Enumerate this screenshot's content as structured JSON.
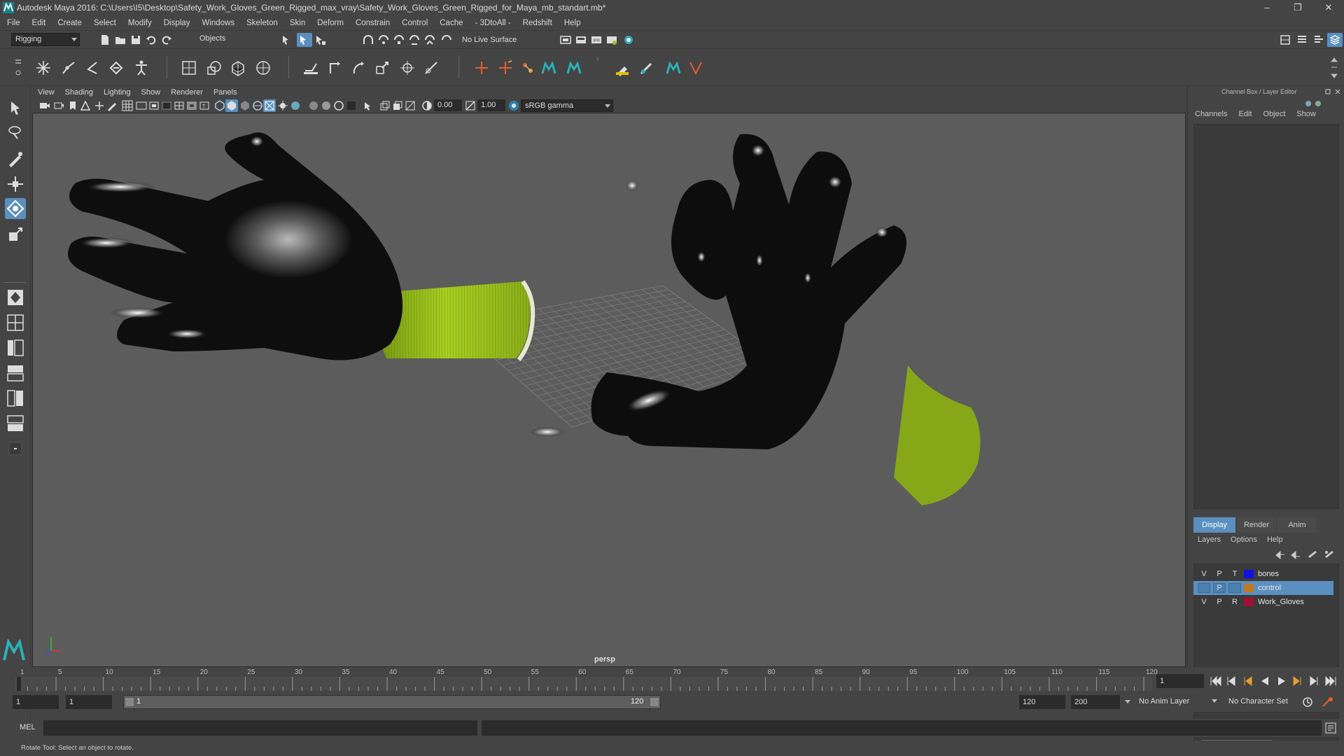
{
  "window": {
    "title": "Autodesk Maya 2016: C:\\Users\\I5\\Desktop\\Safety_Work_Gloves_Green_Rigged_max_vray\\Safety_Work_Gloves_Green_Rigged_for_Maya_mb_standart.mb*",
    "minimize": "–",
    "restore": "❐",
    "close": "✕"
  },
  "menubar": [
    "File",
    "Edit",
    "Create",
    "Select",
    "Modify",
    "Display",
    "Windows",
    "Skeleton",
    "Skin",
    "Deform",
    "Constrain",
    "Control",
    "Cache",
    "- 3DtoAll -",
    "Redshift",
    "Help"
  ],
  "statusline": {
    "mode": "Rigging",
    "selection_mode": "Objects",
    "live_surface": "No Live Surface"
  },
  "panel_menu": [
    "View",
    "Shading",
    "Lighting",
    "Show",
    "Renderer",
    "Panels"
  ],
  "panel_toolbar": {
    "exposure": "0.00",
    "gamma": "1.00",
    "color_space": "sRGB gamma"
  },
  "viewport": {
    "camera_label": "persp"
  },
  "channel_box": {
    "header": "Channel Box / Layer Editor",
    "menu": [
      "Channels",
      "Edit",
      "Object",
      "Show"
    ]
  },
  "layer_editor": {
    "tabs": [
      "Display",
      "Render",
      "Anim"
    ],
    "active_tab": "Display",
    "menu": [
      "Layers",
      "Options",
      "Help"
    ],
    "layers": [
      {
        "v": "V",
        "p": "P",
        "t": "T",
        "name": "bones",
        "color": "#1010e0",
        "selected": false
      },
      {
        "v": "",
        "p": "P",
        "t": "",
        "name": "control",
        "color": "#c07820",
        "selected": true
      },
      {
        "v": "V",
        "p": "P",
        "t": "R",
        "name": "Work_Gloves",
        "color": "#a01030",
        "selected": false
      }
    ]
  },
  "timeline": {
    "ticks": [
      "1",
      "5",
      "10",
      "15",
      "20",
      "25",
      "30",
      "35",
      "40",
      "45",
      "50",
      "55",
      "60",
      "65",
      "70",
      "75",
      "80",
      "85",
      "90",
      "95",
      "100",
      "105",
      "110",
      "115",
      "120"
    ],
    "current_frame": "1"
  },
  "range": {
    "start": "1",
    "playback_start": "1",
    "slider_start": "1",
    "slider_end": "120",
    "playback_end": "120",
    "end": "200",
    "anim_layer": "No Anim Layer",
    "character_set": "No Character Set"
  },
  "command_line": {
    "language": "MEL"
  },
  "help_line": "Rotate Tool: Select an object to rotate.",
  "colors": {
    "accent": "#5a8fbf",
    "glove_green": "#9bc41c",
    "glove_black": "#0c0c0c"
  }
}
